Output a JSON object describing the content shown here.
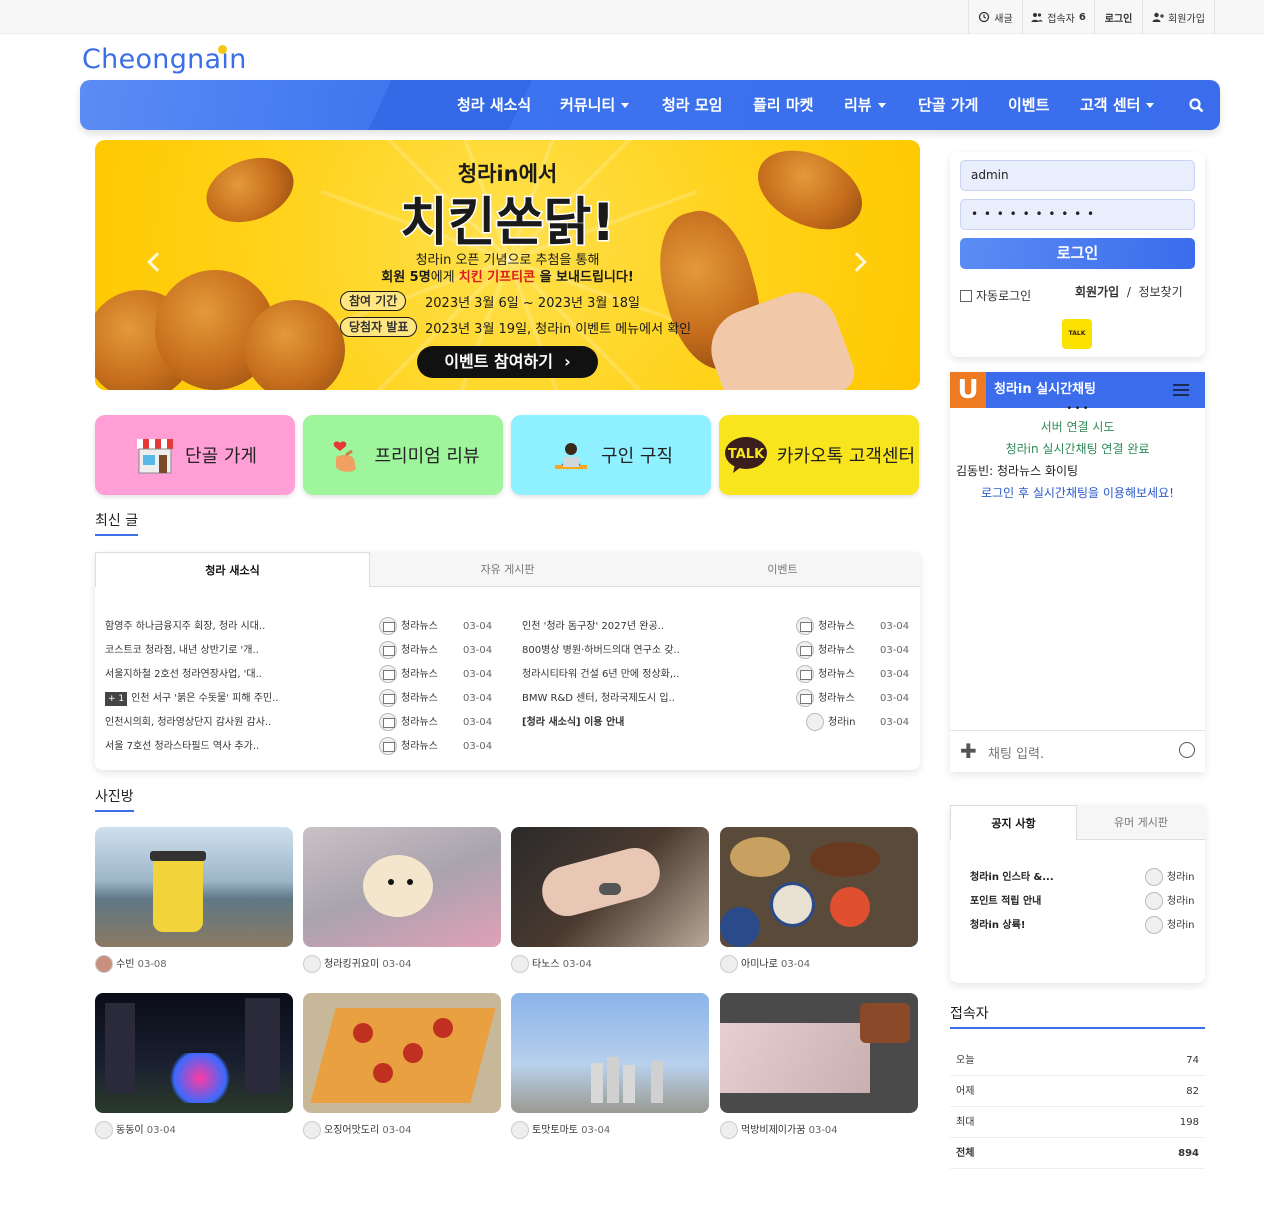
{
  "topbar": {
    "new": "새글",
    "visitors_label": "접속자",
    "visitors_count": "6",
    "login": "로그인",
    "signup": "회원가입"
  },
  "logo": {
    "text": "Cheongna",
    "suffix": "in"
  },
  "nav": {
    "items": [
      {
        "label": "청라 새소식",
        "dropdown": false
      },
      {
        "label": "커뮤니티",
        "dropdown": true
      },
      {
        "label": "청라 모임",
        "dropdown": false
      },
      {
        "label": "플리 마켓",
        "dropdown": false
      },
      {
        "label": "리뷰",
        "dropdown": true
      },
      {
        "label": "단골 가게",
        "dropdown": false
      },
      {
        "label": "이벤트",
        "dropdown": false
      },
      {
        "label": "고객 센터",
        "dropdown": true
      }
    ],
    "search_icon": "search-icon"
  },
  "banner": {
    "top": "청라in에서",
    "title": "치킨쏜닭!",
    "sub1": "청라in 오픈 기념으로 추첨을 통해",
    "sub2_a": "회원 5명",
    "sub2_b": "에게 ",
    "sub2_c": "치킨 기프티콘",
    "sub2_d": " 을 보내드립니다!",
    "period_label": "참여 기간",
    "period_value": "2023년 3월 6일 ~ 2023년 3월 18일",
    "announce_label": "당첨자 발표",
    "announce_value": "2023년 3월 19일, 청라in 이벤트 메뉴에서 확인",
    "cta": "이벤트 참여하기"
  },
  "quick": [
    {
      "label": "단골 가게",
      "color": "#ff9fd6",
      "icon": "shop-icon"
    },
    {
      "label": "프리미엄 리뷰",
      "color": "#9ef59c",
      "icon": "finger-heart-icon"
    },
    {
      "label": "구인 구직",
      "color": "#8ff0ff",
      "icon": "worker-icon"
    },
    {
      "label": "카카오톡 고객센터",
      "color": "#f8e51d",
      "icon": "kakaotalk-icon"
    }
  ],
  "latest": {
    "title": "최신 글",
    "tabs": [
      "청라 새소식",
      "자유 게시판",
      "이벤트"
    ],
    "left": [
      {
        "title": "함영주 하나금융지주 회장, 청라 시대..",
        "author": "청라뉴스",
        "date": "03-04",
        "badge": ""
      },
      {
        "title": "코스트코 청라점, 내년 상반기로 '개..",
        "author": "청라뉴스",
        "date": "03-04",
        "badge": ""
      },
      {
        "title": "서울지하철 2호선 청라연장사업, '대..",
        "author": "청라뉴스",
        "date": "03-04",
        "badge": ""
      },
      {
        "title": "인천 서구 '붉은 수돗물' 피해 주민..",
        "author": "청라뉴스",
        "date": "03-04",
        "badge": "+ 1"
      },
      {
        "title": "인천시의회, 청라영상단지 감사원 감사..",
        "author": "청라뉴스",
        "date": "03-04",
        "badge": ""
      },
      {
        "title": "서울 7호선 청라스타필드 역사 추가..",
        "author": "청라뉴스",
        "date": "03-04",
        "badge": ""
      }
    ],
    "right": [
      {
        "title": "인천 '청라 돔구장' 2027년 완공..",
        "author": "청라뉴스",
        "date": "03-04",
        "bold": false
      },
      {
        "title": "800병상 병원·하버드의대 연구소 갖..",
        "author": "청라뉴스",
        "date": "03-04",
        "bold": false
      },
      {
        "title": "청라시티타워 건설 6년 만에 정상화,..",
        "author": "청라뉴스",
        "date": "03-04",
        "bold": false
      },
      {
        "title": "BMW R&D 센터, 청라국제도시 입..",
        "author": "청라뉴스",
        "date": "03-04",
        "bold": false
      },
      {
        "title": "[청라 새소식] 이용 안내",
        "author": "청라in",
        "date": "03-04",
        "bold": true
      }
    ]
  },
  "photos": {
    "title": "사진방",
    "items": [
      {
        "author": "수빈",
        "date": "03-08"
      },
      {
        "author": "청라킹귀요미",
        "date": "03-04"
      },
      {
        "author": "타노스",
        "date": "03-04"
      },
      {
        "author": "아미나로",
        "date": "03-04"
      },
      {
        "author": "동동이",
        "date": "03-04"
      },
      {
        "author": "오징어맛도리",
        "date": "03-04"
      },
      {
        "author": "토맛토마토",
        "date": "03-04"
      },
      {
        "author": "먹방비제이가꿈",
        "date": "03-04"
      }
    ]
  },
  "login": {
    "username": "admin",
    "password_mask": "• • • • • • • • • •",
    "button": "로그인",
    "auto_login": "자동로그인",
    "signup": "회원가입",
    "sep": "/",
    "find": "정보찾기",
    "kakao": "TALK"
  },
  "chat": {
    "title": "청라in 실시간채팅",
    "dots": "• • •",
    "l1": "서버 연결 시도",
    "l2": "청라in 실시간채팅 연결 완료",
    "l3": "김동빈: 청라뉴스 화이팅",
    "l4": "로그인 후 실시간채팅을 이용해보세요!",
    "placeholder": "채팅 입력."
  },
  "notice": {
    "tabs": [
      "공지 사항",
      "유머 게시판"
    ],
    "items": [
      {
        "title": "청라in 인스타 &...",
        "author": "청라in"
      },
      {
        "title": "포인트 적립 안내",
        "author": "청라in"
      },
      {
        "title": "청라in 상륙!",
        "author": "청라in"
      }
    ]
  },
  "visitors": {
    "title": "접속자",
    "rows": [
      {
        "label": "오늘",
        "value": "74"
      },
      {
        "label": "어제",
        "value": "82"
      },
      {
        "label": "최대",
        "value": "198"
      },
      {
        "label": "전체",
        "value": "894"
      }
    ]
  }
}
